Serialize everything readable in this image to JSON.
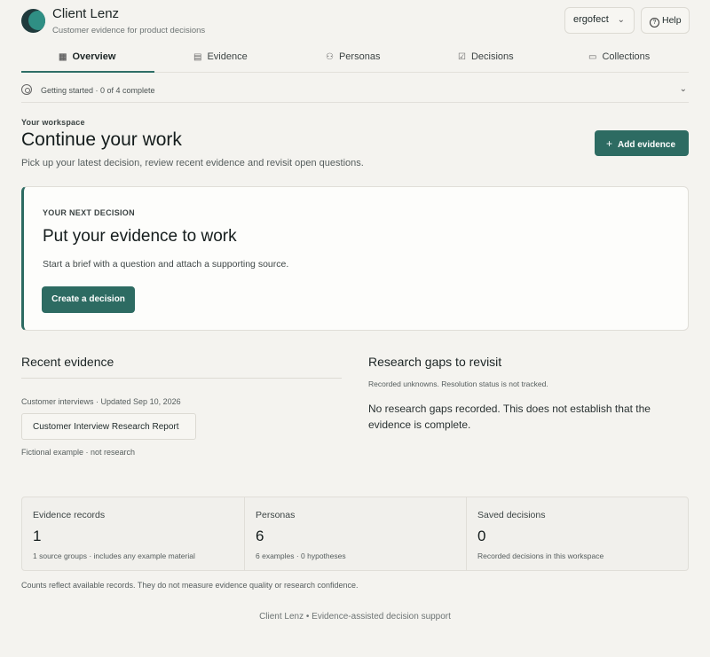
{
  "app": {
    "name": "Client Lenz",
    "tagline": "Customer evidence for product decisions",
    "workspace_select": "ergofect",
    "help_label": "Help"
  },
  "tabs": [
    {
      "label": "Overview",
      "icon": "grid-icon",
      "active": true
    },
    {
      "label": "Evidence",
      "icon": "document-icon"
    },
    {
      "label": "Personas",
      "icon": "people-icon"
    },
    {
      "label": "Decisions",
      "icon": "clipboard-check-icon"
    },
    {
      "label": "Collections",
      "icon": "folder-icon"
    }
  ],
  "getting_started": {
    "text": "Getting started · 0 of 4 complete"
  },
  "workspace": {
    "eyebrow": "Your workspace",
    "title": "Continue your work",
    "description": "Pick up your latest decision, review recent evidence and revisit open questions.",
    "add_button": "Add evidence"
  },
  "next_decision": {
    "eyebrow": "YOUR NEXT DECISION",
    "title": "Put your evidence to work",
    "description": "Start a brief with a question and attach a supporting source.",
    "button": "Create a decision"
  },
  "recent_evidence": {
    "title": "Recent evidence",
    "meta": "Customer interviews · Updated Sep 10, 2026",
    "item": "Customer Interview Research Report",
    "note": "Fictional example · not research"
  },
  "research_gaps": {
    "title": "Research gaps to revisit",
    "meta": "Recorded unknowns. Resolution status is not tracked.",
    "empty": "No research gaps recorded. This does not establish that the evidence is complete."
  },
  "stats": [
    {
      "label": "Evidence records",
      "value": "1",
      "sub": "1 source groups · includes any example material"
    },
    {
      "label": "Personas",
      "value": "6",
      "sub": "6 examples · 0 hypotheses"
    },
    {
      "label": "Saved decisions",
      "value": "0",
      "sub": "Recorded decisions in this workspace"
    }
  ],
  "counts_note": "Counts reflect available records. They do not measure evidence quality or research confidence.",
  "footer": "Client Lenz • Evidence-assisted decision support",
  "colors": {
    "accent": "#2d6b62",
    "background": "#f4f3ef"
  }
}
